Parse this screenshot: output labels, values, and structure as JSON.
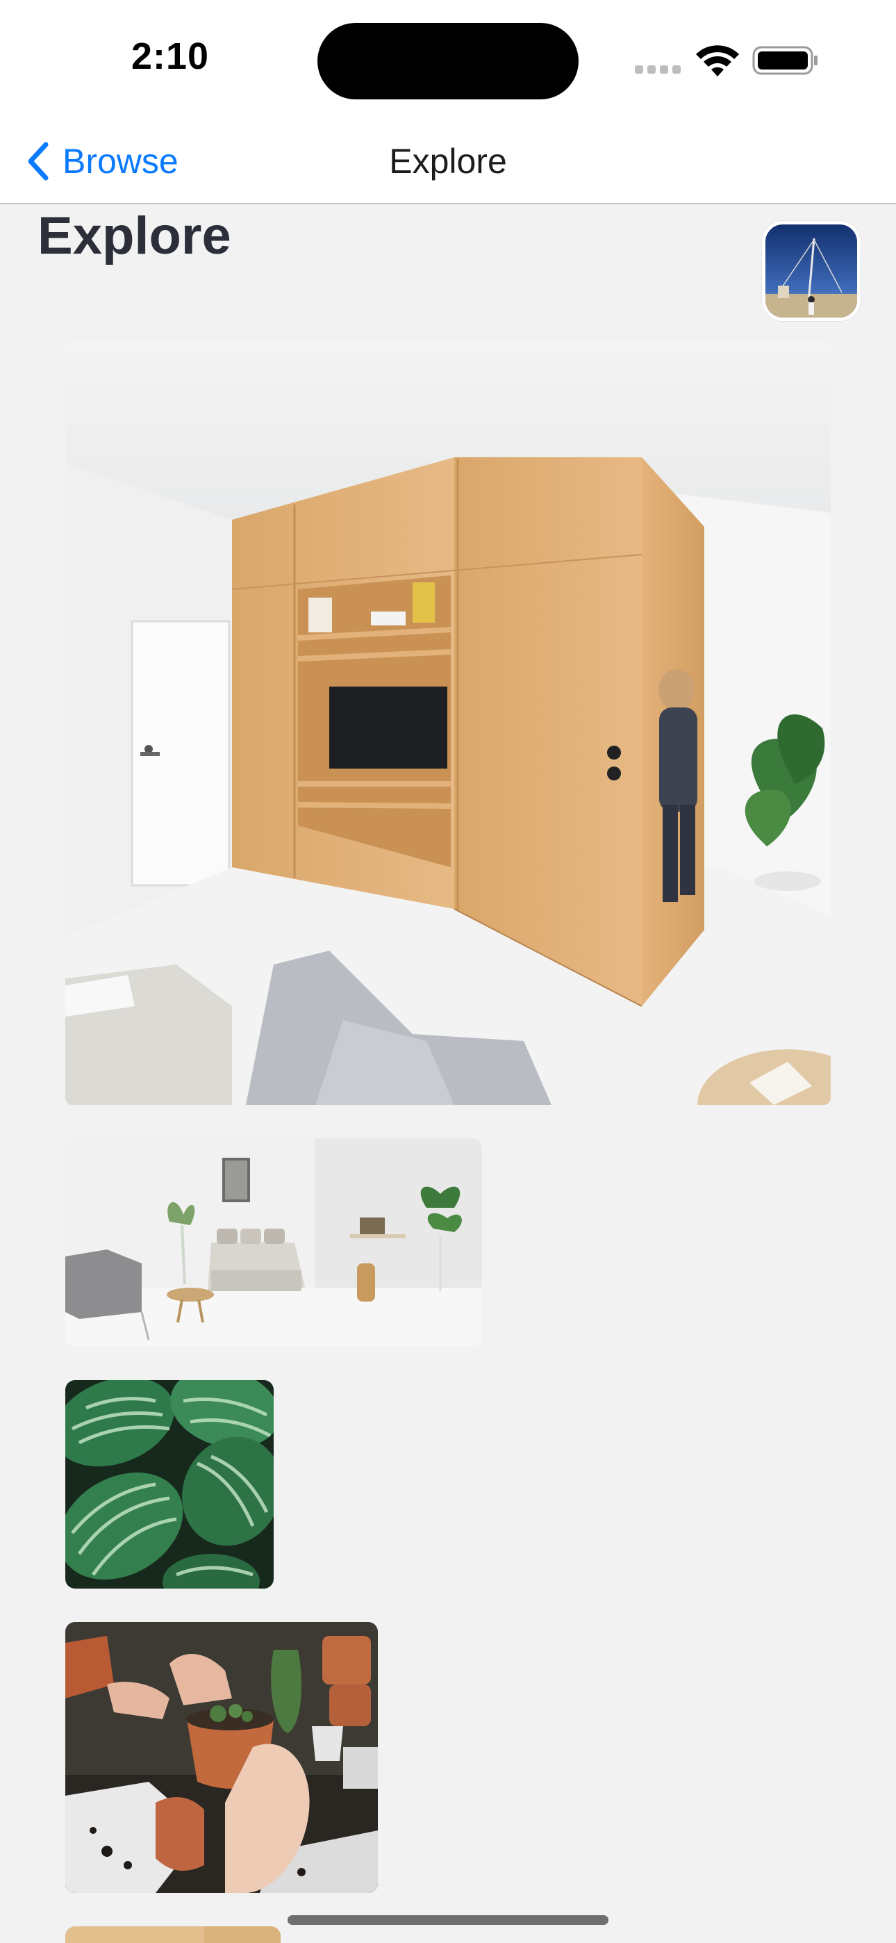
{
  "status_bar": {
    "time": "2:10",
    "icons": [
      "cellular-signal-icon",
      "wifi-icon",
      "battery-icon"
    ]
  },
  "nav": {
    "back_label": "Browse",
    "title": "Explore",
    "back_icon": "chevron-left-icon"
  },
  "header": {
    "title": "Explore",
    "avatar": "profile-avatar"
  },
  "colors": {
    "accent": "#0a7aff",
    "background": "#f2f2f2",
    "title_text": "#2c2f3a"
  },
  "photos": [
    {
      "subject": "wooden-cabinet-room"
    },
    {
      "subject": "bedroom"
    },
    {
      "subject": "calathea-leaves"
    },
    {
      "subject": "potting-cactus"
    },
    {
      "subject": "wood-partial"
    }
  ]
}
